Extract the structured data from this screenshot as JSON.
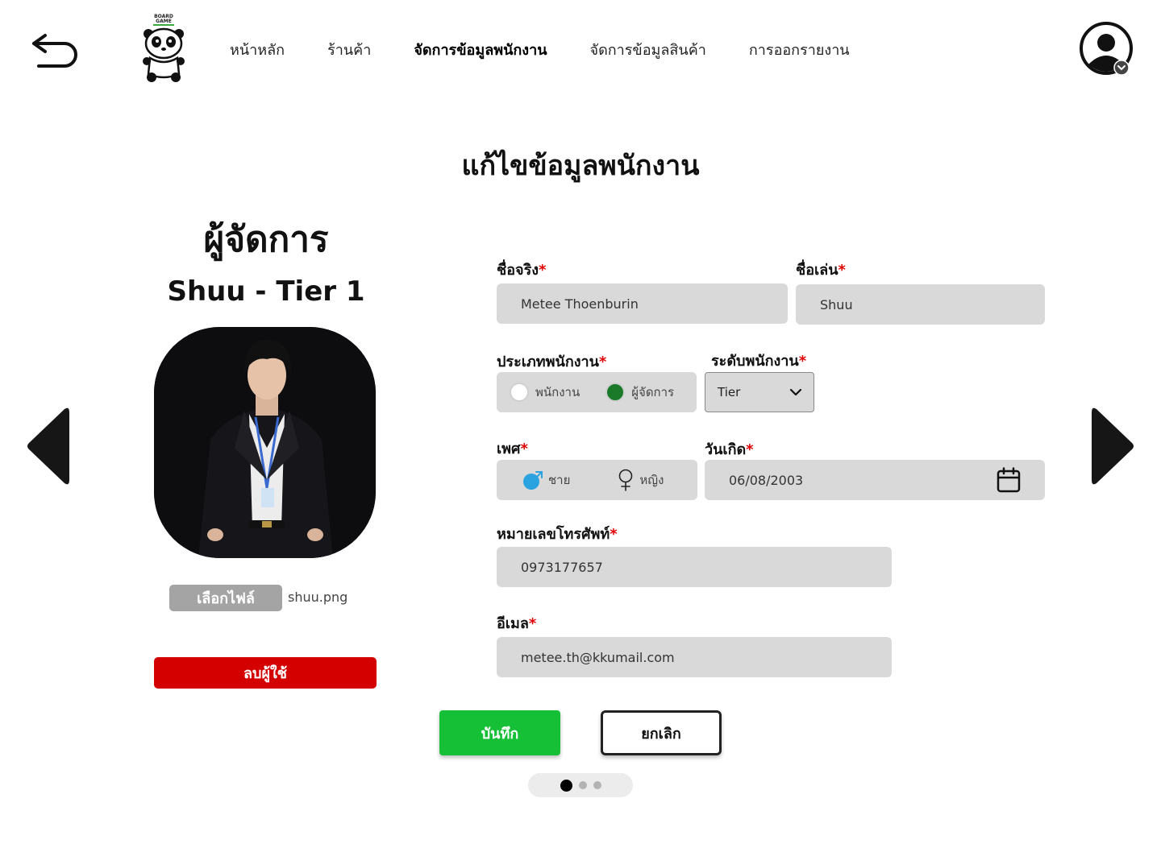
{
  "header": {
    "logo_text": "BOARD GAME",
    "nav": [
      {
        "label": "หน้าหลัก",
        "active": false
      },
      {
        "label": "ร้านค้า",
        "active": false
      },
      {
        "label": "จัดการข้อมูลพนักงาน",
        "active": true
      },
      {
        "label": "จัดการข้อมูลสินค้า",
        "active": false
      },
      {
        "label": "การออกรายงาน",
        "active": false
      }
    ]
  },
  "page": {
    "title": "แก้ไขข้อมูลพนักงาน"
  },
  "profile": {
    "role": "ผู้จัดการ",
    "name_tier": "Shuu - Tier 1",
    "file_button": "เลือกไฟล์",
    "file_name": "shuu.png",
    "delete_button": "ลบผู้ใช้"
  },
  "form": {
    "real_name": {
      "label": "ชื่อจริง",
      "required": "*",
      "value": "Metee Thoenburin"
    },
    "nickname": {
      "label": "ชื่อเล่น",
      "required": "*",
      "value": "Shuu"
    },
    "employee_type": {
      "label": "ประเภทพนักงาน",
      "required": "*",
      "options": [
        {
          "label": "พนักงาน",
          "selected": false
        },
        {
          "label": "ผู้จัดการ",
          "selected": true
        }
      ]
    },
    "employee_level": {
      "label": "ระดับพนักงาน",
      "required": "*",
      "value": "Tier"
    },
    "gender": {
      "label": "เพศ",
      "required": "*",
      "options": [
        {
          "label": "ชาย",
          "icon": "male-icon"
        },
        {
          "label": "หญิง",
          "icon": "female-icon"
        }
      ]
    },
    "birthdate": {
      "label": "วันเกิด",
      "required": "*",
      "value": "06/08/2003"
    },
    "phone": {
      "label": "หมายเลขโทรศัพท์",
      "required": "*",
      "value": "0973177657"
    },
    "email": {
      "label": "อีเมล",
      "required": "*",
      "value": "metee.th@kkumail.com"
    }
  },
  "actions": {
    "save": "บันทึก",
    "cancel": "ยกเลิก"
  },
  "pager": {
    "total": 3,
    "current": 1
  },
  "colors": {
    "save": "#16c036",
    "delete": "#d40000",
    "field_bg": "#d9d9d9",
    "required": "#e00000",
    "male": "#2aa3e0",
    "radio_selected": "#1b7a2a"
  }
}
